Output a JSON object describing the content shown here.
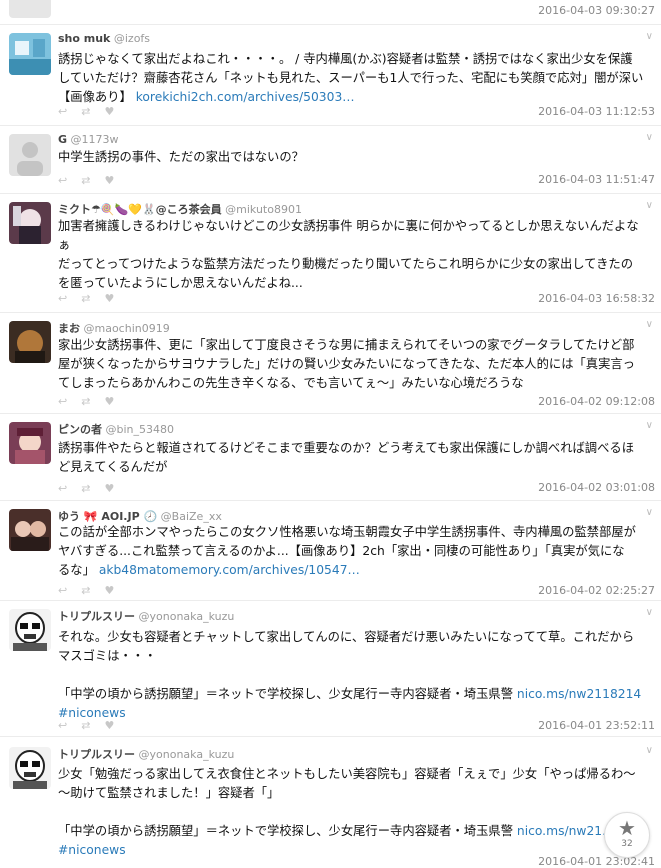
{
  "tweets": [
    {
      "name": "",
      "handle": "",
      "lines": [],
      "link": "",
      "link2": "",
      "time": "2016-04-03 09:30:27"
    },
    {
      "name": "sho muk",
      "handle": "@izofs",
      "lines": [
        "誘拐じゃなくて家出だよねこれ・・・・。 / 寺内樺風(かぶ)容疑者は監禁・誘拐ではなく家出少女を保護",
        "していただけ？齋藤杏花さん「ネットも見れた、スーパーも1人で行った、宅配にも笑顔で応対」闇が深い",
        "【画像あり】 "
      ],
      "link": "korekichi2ch.com/archives/50303…",
      "link2": "",
      "time": "2016-04-03 11:12:53"
    },
    {
      "name": "G",
      "handle": "@1173w",
      "lines": [
        "中学生誘拐の事件、ただの家出ではないの？"
      ],
      "link": "",
      "link2": "",
      "time": "2016-04-03 11:51:47"
    },
    {
      "name": "ミクト☂🍭🍆💛🐰@ころ茶会員",
      "handle": "@mikuto8901",
      "lines": [
        "加害者擁護しきるわけじゃないけどこの少女誘拐事件 明らかに裏に何かやってるとしか思えないんだよな",
        "ぁ",
        "だってとってつけたような監禁方法だったり動機だったり聞いてたらこれ明らかに少女の家出してきたの",
        "を匿っていたようにしか思えないんだよね..."
      ],
      "link": "",
      "link2": "",
      "time": "2016-04-03 16:58:32"
    },
    {
      "name": "まお",
      "handle": "@maochin0919",
      "lines": [
        "家出少女誘拐事件、更に「家出して丁度良さそうな男に捕まえられてそいつの家でグータラしてたけど部",
        "屋が狭くなったからサヨウナラした」だけの賢い少女みたいになってきたな、ただ本人的には「真実言っ",
        "てしまったらあかんわこの先生き辛くなる、でも言いてぇ〜」みたいな心境だろうな"
      ],
      "link": "",
      "link2": "",
      "time": "2016-04-02 09:12:08"
    },
    {
      "name": "ピンの者",
      "handle": "@bin_53480",
      "lines": [
        "誘拐事件やたらと報道されてるけどそこまで重要なのか？どう考えても家出保護にしか調べれば調べるほ",
        "ど見えてくるんだが"
      ],
      "link": "",
      "link2": "",
      "time": "2016-04-02 03:01:08"
    },
    {
      "name": "ゆう 🎀 AOI.JP 🕗",
      "handle": "@BaiZe_xx",
      "lines": [
        "この話が全部ホンマやったらこの女クソ性格悪いな埼玉朝霞女子中学生誘拐事件、寺内樺風の監禁部屋が",
        "ヤバすぎる...これ監禁って言えるのかよ...【画像あり】2ch「家出・同棲の可能性あり」「真実が気にな",
        "るな」 "
      ],
      "link": "akb48matomemory.com/archives/10547…",
      "link2": "",
      "time": "2016-04-02 02:25:27"
    },
    {
      "name": "トリプルスリー",
      "handle": "@yononaka_kuzu",
      "lines": [
        "それな。少女も容疑者とチャットして家出してんのに、容疑者だけ悪いみたいになってて草。これだから",
        "マスゴミは・・・",
        "",
        "「中学の頃から誘拐願望」＝ネットで学校探し、少女尾行ー寺内容疑者・埼玉県警 "
      ],
      "link": "nico.ms/nw2118214",
      "link2": "#niconews",
      "time": "2016-04-01 23:52:11"
    },
    {
      "name": "トリプルスリー",
      "handle": "@yononaka_kuzu",
      "lines": [
        "少女「勉強だっる家出してえ衣食住とネットもしたい美容院も」容疑者「えぇで」少女「やっぱ帰るわ〜",
        "〜助けて監禁されました！」容疑者「」",
        "",
        "「中学の頃から誘拐願望」＝ネットで学校探し、少女尾行ー寺内容疑者・埼玉県警 "
      ],
      "link": "nico.ms/nw21…",
      "link2": "#niconews",
      "time": "2016-04-01 23:02:41"
    }
  ],
  "fab": {
    "icon": "star-icon",
    "count": "32"
  },
  "colors": {
    "link": "#2b7bb9",
    "muted": "#888888"
  }
}
